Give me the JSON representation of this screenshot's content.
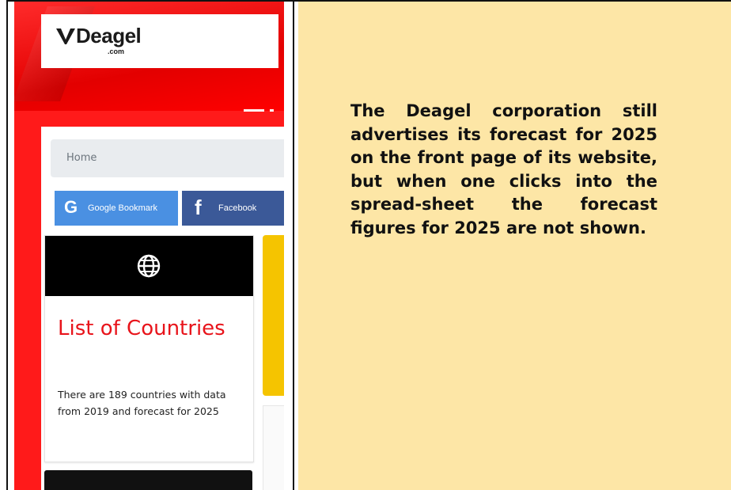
{
  "website": {
    "logo_text": "Deagel",
    "logo_sub": ".com",
    "home_label": "Home",
    "google_button": "Google Bookmark",
    "facebook_button": "Facebook",
    "card_title": "List of Countries",
    "card_text": "There are 189 countries with data from 2019 and forecast for 2025"
  },
  "caption": {
    "text": "The Deagel corporation still advertises its forecast for 2025 on the front page of its website, but when one clicks into the spread-sheet the forecast figures for 2025 are not shown."
  },
  "colors": {
    "brand_red": "#ff1a1a",
    "caption_background": "#fde6a6",
    "google_blue": "#4a90e2",
    "facebook_blue": "#3b5998",
    "title_red": "#e8141b"
  }
}
